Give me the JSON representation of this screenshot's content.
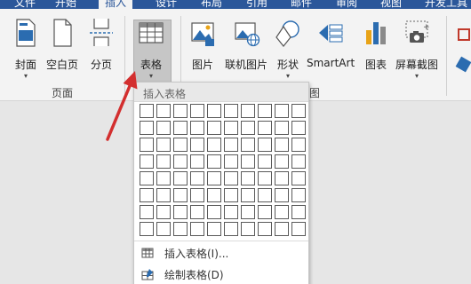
{
  "tabs": [
    "文件",
    "开始",
    "插入",
    "设计",
    "布局",
    "引用",
    "邮件",
    "审阅",
    "视图",
    "开发工具"
  ],
  "active_tab_index": 2,
  "ribbon": {
    "pages_group": {
      "label": "页面",
      "buttons": [
        {
          "label": "封面",
          "icon": "cover-page-icon",
          "has_dropdown": true
        },
        {
          "label": "空白页",
          "icon": "blank-page-icon",
          "has_dropdown": false
        },
        {
          "label": "分页",
          "icon": "page-break-icon",
          "has_dropdown": false
        }
      ]
    },
    "tables_group": {
      "buttons": [
        {
          "label": "表格",
          "icon": "table-icon",
          "has_dropdown": true
        }
      ]
    },
    "illustrations_group": {
      "label_partial": "图",
      "buttons": [
        {
          "label": "图片",
          "icon": "picture-icon"
        },
        {
          "label": "联机图片",
          "icon": "online-picture-icon"
        },
        {
          "label": "形状",
          "icon": "shapes-icon",
          "has_dropdown": true
        },
        {
          "label": "SmartArt",
          "icon": "smartart-icon"
        },
        {
          "label": "图表",
          "icon": "chart-icon"
        },
        {
          "label": "屏幕截图",
          "icon": "screenshot-icon",
          "has_dropdown": true
        }
      ]
    }
  },
  "dropdown": {
    "header": "插入表格",
    "grid": {
      "columns": 10,
      "rows": 8
    },
    "items": [
      {
        "label": "插入表格(I)...",
        "icon": "insert-table-icon"
      },
      {
        "label": "绘制表格(D)",
        "icon": "draw-table-icon"
      }
    ]
  },
  "colors": {
    "tab_bar": "#2b579a",
    "ribbon_bg": "#f3f3f3",
    "active_button_bg": "#c6c6c6",
    "annotation_arrow": "#d32f2f"
  },
  "annotation": {
    "type": "arrow",
    "points_to": "table-button"
  }
}
